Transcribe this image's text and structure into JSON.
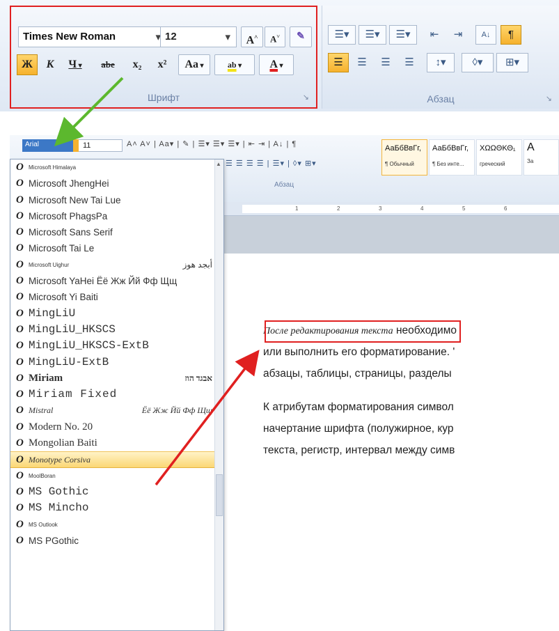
{
  "top_ribbon": {
    "font_group": {
      "font_name": "Times New Roman",
      "font_size": "12",
      "grow_label": "A",
      "shrink_label": "A",
      "bold_label": "Ж",
      "italic_label": "К",
      "underline_label": "Ч",
      "strike_label": "abe",
      "subscript_label": "x₂",
      "superscript_label": "x²",
      "case_label": "Aa",
      "highlight_label": "ab",
      "font_color_label": "A",
      "label": "Шрифт"
    },
    "paragraph_group": {
      "label": "Абзац",
      "sort_label": "А↓",
      "pilcrow_label": "¶"
    }
  },
  "mini_ribbon": {
    "font_name": "Arial",
    "font_size": "11",
    "tools_row1": "A˄ A˅ | Aa▾ | ✎ | ☰▾ ☰▾ ☰▾ | ⇤ ⇥ | A↓ | ¶",
    "tools_row2": "☰ ☰ ☰ ☰ | ☰▾ | ◊▾ ⊞▾",
    "paragraph_label": "Абзац",
    "styles": [
      {
        "sample": "АаБбВвГг,",
        "name": "¶ Обычный"
      },
      {
        "sample": "АаБбВвГг,",
        "name": "¶ Без инте..."
      },
      {
        "sample": "ΧΩΩΘΚΘ₁",
        "name": "греческий"
      },
      {
        "sample": "А",
        "name": "За"
      }
    ]
  },
  "ruler_ticks": [
    "1",
    "2",
    "3",
    "4",
    "5",
    "6"
  ],
  "font_list": [
    {
      "name": "Microsoft Himalaya",
      "style": "tiny"
    },
    {
      "name": "Microsoft JhengHei",
      "style": "plain"
    },
    {
      "name": "Microsoft New Tai Lue",
      "style": "plain"
    },
    {
      "name": "Microsoft PhagsPa",
      "style": "plain"
    },
    {
      "name": "Microsoft Sans Serif",
      "style": "plain"
    },
    {
      "name": "Microsoft Tai Le",
      "style": "plain"
    },
    {
      "name": "Microsoft Uighur",
      "style": "tiny",
      "sample": "أبجد هوز"
    },
    {
      "name": "Microsoft YaHei Ёё Жж Йй Фф Щщ",
      "style": "plain"
    },
    {
      "name": "Microsoft Yi Baiti",
      "style": "plain"
    },
    {
      "name": "MingLiU",
      "style": "mono"
    },
    {
      "name": "MingLiU_HKSCS",
      "style": "mono"
    },
    {
      "name": "MingLiU_HKSCS-ExtB",
      "style": "mono"
    },
    {
      "name": "MingLiU-ExtB",
      "style": "mono"
    },
    {
      "name": "Miriam",
      "style": "serif-bold",
      "sample": "אבגד הוז"
    },
    {
      "name": "Miriam Fixed",
      "style": "wide"
    },
    {
      "name": "Mistral",
      "style": "script",
      "sample": "Ёё Жж Йй Фф Щщ"
    },
    {
      "name": "Modern No. 20",
      "style": "serif"
    },
    {
      "name": "Mongolian Baiti",
      "style": "serif"
    },
    {
      "name": "Monotype Corsiva",
      "style": "script",
      "selected": true
    },
    {
      "name": "MoolBoran",
      "style": "tiny"
    },
    {
      "name": "MS Gothic",
      "style": "mono"
    },
    {
      "name": "MS Mincho",
      "style": "mono"
    },
    {
      "name": "MS Outlook",
      "style": "tiny"
    },
    {
      "name": "MS PGothic",
      "style": "plain"
    }
  ],
  "document": {
    "line1_italic": "После редактирования текста",
    "line1_rest": " необходимо",
    "line2": "или выполнить его форматирование. '",
    "line3": "абзацы, таблицы, страницы, разделы",
    "line4": "К атрибутам форматирования символ",
    "line5": "начертание шрифта (полужирное, кур",
    "line6": "текста, регистр, интервал между симв"
  },
  "colors": {
    "highlight_frame": "#e02020",
    "green_arrow": "#5cb82e",
    "red_arrow": "#e02020",
    "selection": "#fbd774"
  }
}
